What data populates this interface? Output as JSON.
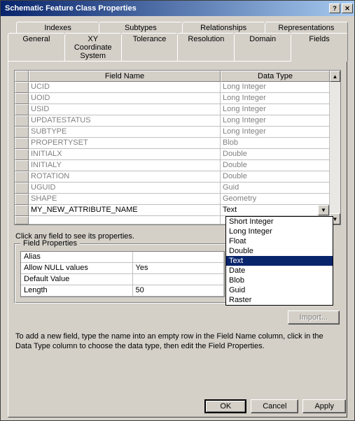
{
  "title": "Schematic Feature Class Properties",
  "tabs_row1": [
    {
      "label": "Indexes"
    },
    {
      "label": "Subtypes"
    },
    {
      "label": "Relationships"
    },
    {
      "label": "Representations"
    }
  ],
  "tabs_row2": [
    {
      "label": "General"
    },
    {
      "label": "XY Coordinate System"
    },
    {
      "label": "Tolerance"
    },
    {
      "label": "Resolution"
    },
    {
      "label": "Domain"
    },
    {
      "label": "Fields",
      "active": true
    }
  ],
  "grid": {
    "col1": "Field Name",
    "col2": "Data Type"
  },
  "rows": [
    {
      "name": "UCID",
      "type": "Long Integer",
      "editable": false
    },
    {
      "name": "UOID",
      "type": "Long Integer",
      "editable": false
    },
    {
      "name": "USID",
      "type": "Long Integer",
      "editable": false
    },
    {
      "name": "UPDATESTATUS",
      "type": "Long Integer",
      "editable": false
    },
    {
      "name": "SUBTYPE",
      "type": "Long Integer",
      "editable": false
    },
    {
      "name": "PROPERTYSET",
      "type": "Blob",
      "editable": false
    },
    {
      "name": "INITIALX",
      "type": "Double",
      "editable": false
    },
    {
      "name": "INITIALY",
      "type": "Double",
      "editable": false
    },
    {
      "name": "ROTATION",
      "type": "Double",
      "editable": false
    },
    {
      "name": "UGUID",
      "type": "Guid",
      "editable": false
    },
    {
      "name": "SHAPE",
      "type": "Geometry",
      "editable": false
    },
    {
      "name": "MY_NEW_ATTRIBUTE_NAME",
      "type": "Text",
      "editable": true,
      "dd": true
    }
  ],
  "dd_options": [
    "Short Integer",
    "Long Integer",
    "Float",
    "Double",
    "Text",
    "Date",
    "Blob",
    "Guid",
    "Raster"
  ],
  "dd_selected": "Text",
  "help": "Click any field to see its properties.",
  "fieldprops": {
    "legend": "Field Properties",
    "rows": [
      {
        "k": "Alias",
        "v": ""
      },
      {
        "k": "Allow NULL values",
        "v": "Yes"
      },
      {
        "k": "Default Value",
        "v": ""
      },
      {
        "k": "Length",
        "v": "50"
      }
    ]
  },
  "import_label": "Import...",
  "instructions": "To add a new field, type the name into an empty row in the Field Name column, click in the Data Type column to choose the data type, then edit the Field Properties.",
  "buttons": {
    "ok": "OK",
    "cancel": "Cancel",
    "apply": "Apply"
  }
}
